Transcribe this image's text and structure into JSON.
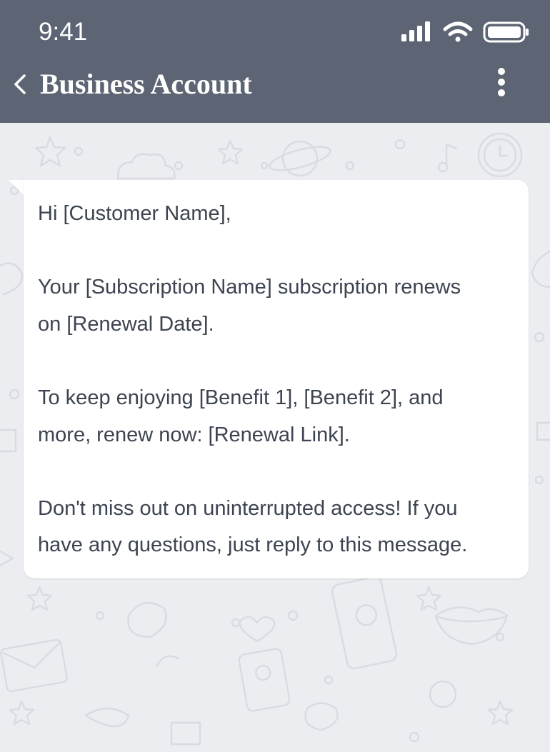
{
  "status_bar": {
    "time": "9:41"
  },
  "header": {
    "title": "Business Account",
    "back_icon": "chevron-left-icon",
    "menu_icon": "more-vertical-icon"
  },
  "message": {
    "lines": [
      "Hi [Customer Name],",
      "",
      "Your [Subscription Name] subscription renews",
      "on [Renewal Date].",
      "",
      "To keep enjoying [Benefit 1], [Benefit 2], and",
      "more, renew now: [Renewal Link].",
      "",
      "Don't miss out on uninterrupted access! If you",
      "have any questions, just reply to this message."
    ]
  },
  "colors": {
    "header_bg": "#5d6473",
    "chat_bg": "#ebedf0",
    "bubble_bg": "#ffffff",
    "text": "#3d4451"
  }
}
